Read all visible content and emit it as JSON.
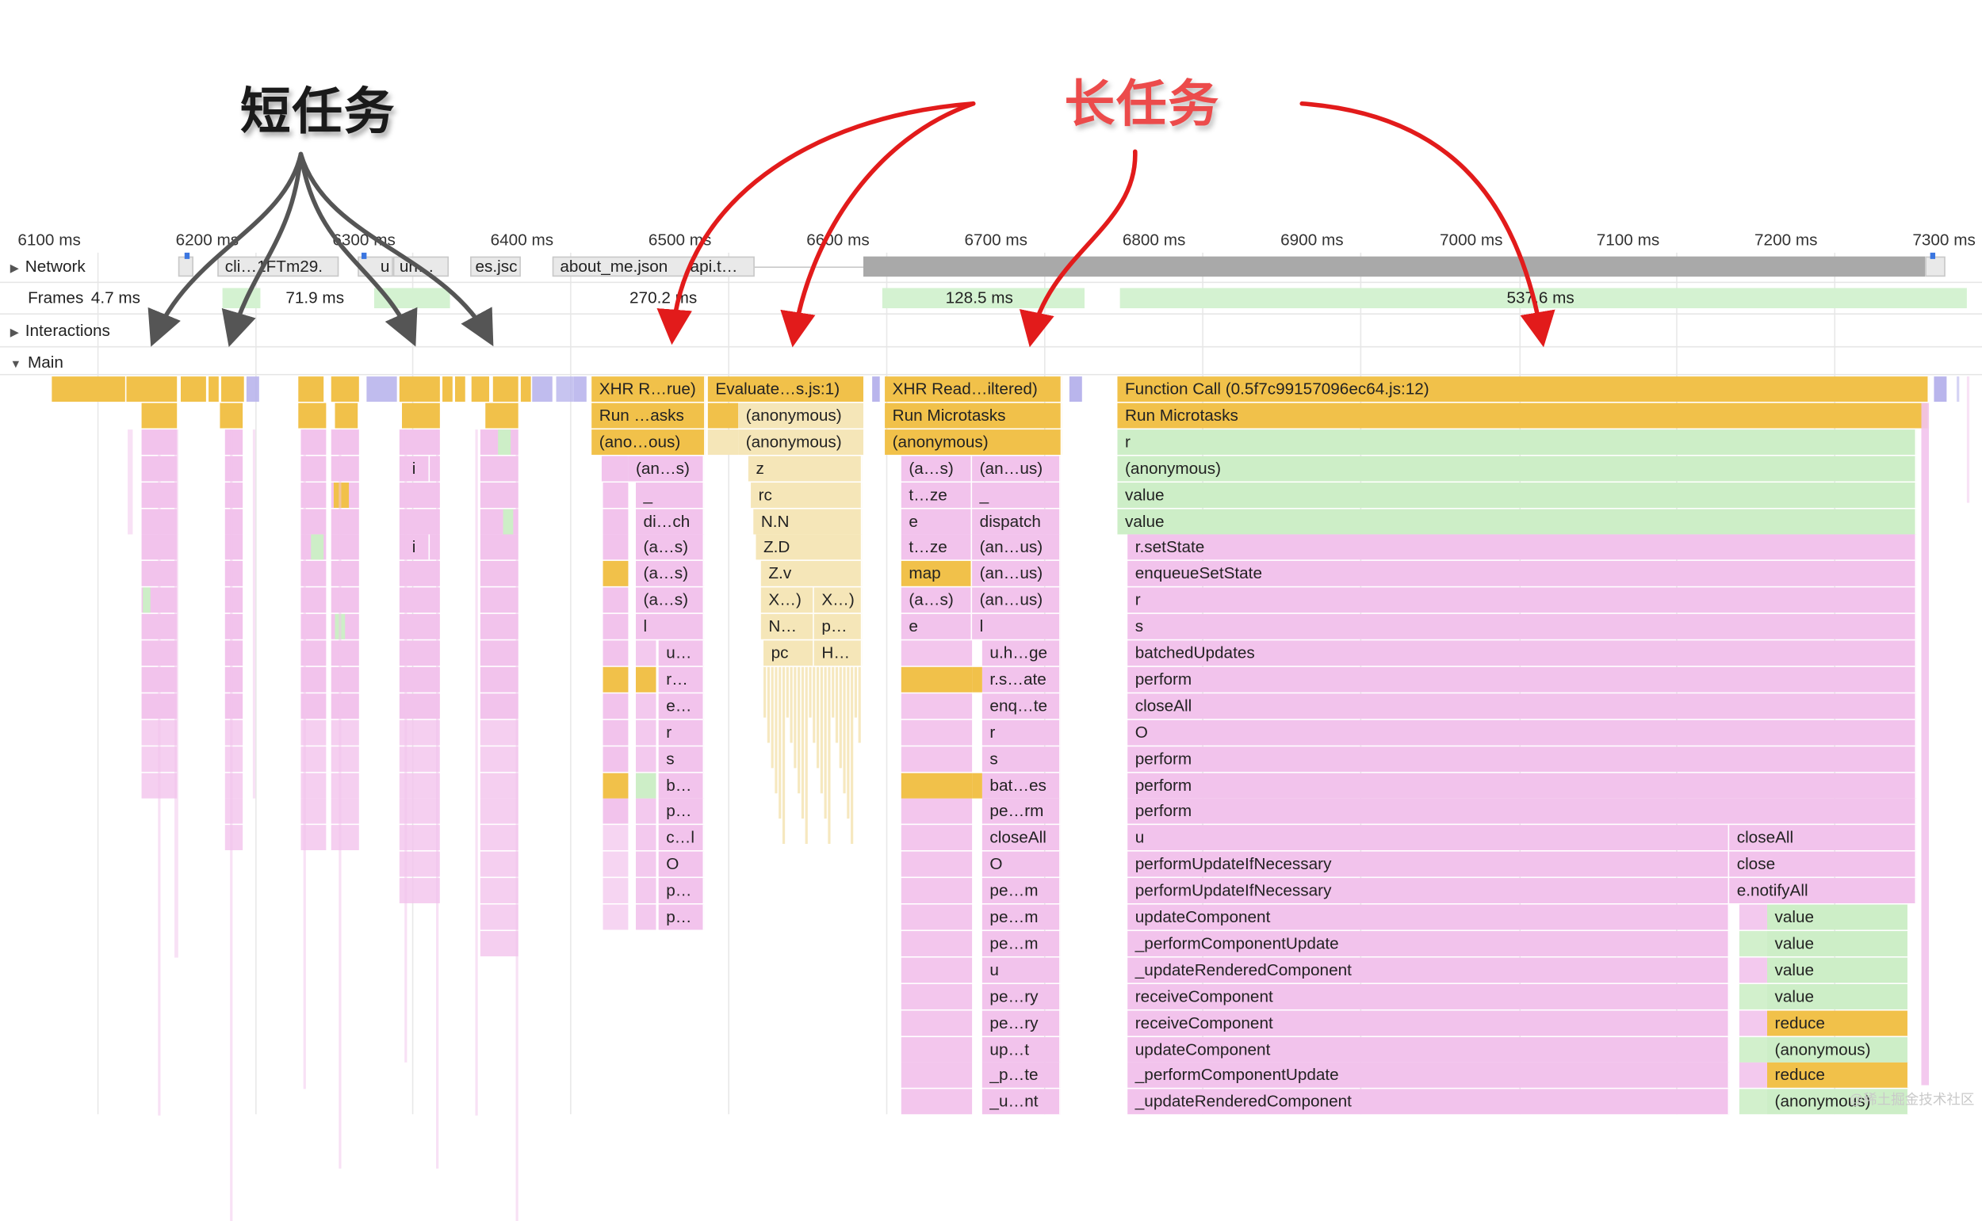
{
  "headlines": {
    "short_tasks": "短任务",
    "long_tasks": "长任务"
  },
  "colors": {
    "short_arrow": "#555555",
    "long_arrow": "#e21b1b",
    "scripting_yellow": "#f1c14a",
    "pink": "#f2c3ec",
    "green": "#cdeec7"
  },
  "ruler": {
    "ticks": [
      "6100 ms",
      "6200 ms",
      "6300 ms",
      "6400 ms",
      "6500 ms",
      "6600 ms",
      "6700 ms",
      "6800 ms",
      "6900 ms",
      "7000 ms",
      "7100 ms",
      "7200 ms",
      "7300 ms"
    ]
  },
  "tracks": {
    "network": "Network",
    "frames": "Frames",
    "interactions": "Interactions",
    "main": "Main"
  },
  "network_labels": [
    "cli…1FTm29.",
    "u",
    "un…",
    "es.jsc",
    "about_me.json",
    "api.t…"
  ],
  "frame_durations": [
    "4.7 ms",
    "71.9 ms",
    "270.2 ms",
    "128.5 ms",
    "537.6 ms"
  ],
  "flame": {
    "group_xhr1": [
      "XHR R…rue)",
      "Run …asks",
      "(ano…ous)",
      "(an…s)",
      "_",
      "di…ch",
      "(a…s)",
      "(a…s)",
      "(a…s)",
      "l",
      "u…",
      "r…",
      "e…",
      "r",
      "s",
      "b…",
      "p…",
      "c…l",
      "O",
      "p…",
      "p…"
    ],
    "group_eval": [
      "Evaluate…s.js:1)",
      "(anonymous)",
      "(anonymous)",
      "z",
      "rc",
      "N.N",
      "Z.D",
      "Z.v",
      "X…)",
      "X…)",
      "N…",
      "p…",
      "pc",
      "H…"
    ],
    "group_xhr2_left": [
      "XHR Read…iltered)",
      "Run Microtasks",
      "(anonymous)",
      "(a…s)",
      "t…ze",
      "e",
      "t…ze",
      "map",
      "(a…s)",
      "e"
    ],
    "group_xhr2_right": [
      "(an…us)",
      "_",
      "dispatch",
      "(an…us)",
      "(an…us)",
      "(an…us)",
      "l",
      "u.h…ge",
      "r.s…ate",
      "enq…te",
      "r",
      "s",
      "bat…es",
      "pe…rm",
      "closeAll",
      "O",
      "pe…m",
      "pe…m",
      "pe…m",
      "u",
      "pe…ry",
      "pe…ry",
      "up…t",
      "_p…te",
      "_u…nt"
    ],
    "group_function_call": [
      "Function Call (0.5f7c99157096ec64.js:12)",
      "Run Microtasks",
      "r",
      "(anonymous)",
      "value",
      "value",
      "r.setState",
      "enqueueSetState",
      "r",
      "s",
      "batchedUpdates",
      "perform",
      "closeAll",
      "O",
      "perform",
      "perform",
      "perform",
      "u",
      "performUpdateIfNecessary",
      "performUpdateIfNecessary",
      "updateComponent",
      "_performComponentUpdate",
      "_updateRenderedComponent",
      "receiveComponent",
      "receiveComponent",
      "updateComponent",
      "_performComponentUpdate",
      "_updateRenderedComponent"
    ],
    "group_function_call_right": [
      "closeAll",
      "close",
      "e.notifyAll",
      "value",
      "value",
      "value",
      "value",
      "reduce",
      "(anonymous)",
      "reduce",
      "(anonymous)"
    ],
    "short_task_labels": [
      "i",
      "i"
    ]
  },
  "watermark": "@稀土掘金技术社区"
}
